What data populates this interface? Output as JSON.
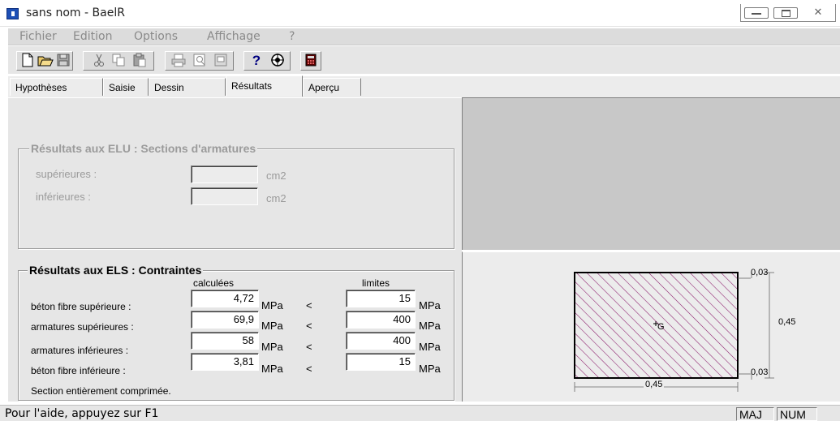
{
  "window": {
    "title": "sans nom - BaelR",
    "controls": {
      "minimize": "—",
      "maximize": "□",
      "close": "✕"
    }
  },
  "menu": [
    "Fichier",
    "Edition",
    "Options",
    "Affichage",
    "?"
  ],
  "toolbar": {
    "icons": [
      "new-file-icon",
      "open-folder-icon",
      "save-icon",
      "cut-icon",
      "copy-icon",
      "paste-icon",
      "print-icon",
      "print-preview-icon",
      "page-setup-icon",
      "help-icon",
      "context-help-icon",
      "calculator-icon"
    ],
    "help_glyph": "?"
  },
  "tabs": [
    "Hypothèses",
    "Saisie",
    "Dessin",
    "Résultats",
    "Aperçu"
  ],
  "active_tab": "Résultats",
  "elu": {
    "title": "Résultats aux ELU : Sections d'armatures",
    "rows": [
      {
        "label": "supérieures :",
        "value": "",
        "unit": "cm2"
      },
      {
        "label": "inférieures :",
        "value": "",
        "unit": "cm2"
      }
    ]
  },
  "els": {
    "title": "Résultats aux ELS : Contraintes",
    "col_calc": "calculées",
    "col_lim": "limites",
    "rows": [
      {
        "label": "béton fibre supérieure :",
        "calc": "4,72",
        "unit1": "MPa",
        "op": "<",
        "limit": "15",
        "unit2": "MPa"
      },
      {
        "label": "armatures supérieures :",
        "calc": "69,9",
        "unit1": "MPa",
        "op": "<",
        "limit": "400",
        "unit2": "MPa"
      },
      {
        "label": "armatures inférieures :",
        "calc": "58",
        "unit1": "MPa",
        "op": "<",
        "limit": "400",
        "unit2": "MPa"
      },
      {
        "label": "béton fibre inférieure :",
        "calc": "3,81",
        "unit1": "MPa",
        "op": "<",
        "limit": "15",
        "unit2": "MPa"
      }
    ],
    "summary": "Section entièrement comprimée."
  },
  "drawing": {
    "top_cover": "0,03",
    "bottom_cover": "0,03",
    "height": "0,45",
    "width": "0,45",
    "centroid": "G",
    "hatch_color": "#8b1a6b"
  },
  "status": {
    "help": "Pour l'aide, appuyez sur F1",
    "caps": "MAJ",
    "num": "NUM"
  }
}
